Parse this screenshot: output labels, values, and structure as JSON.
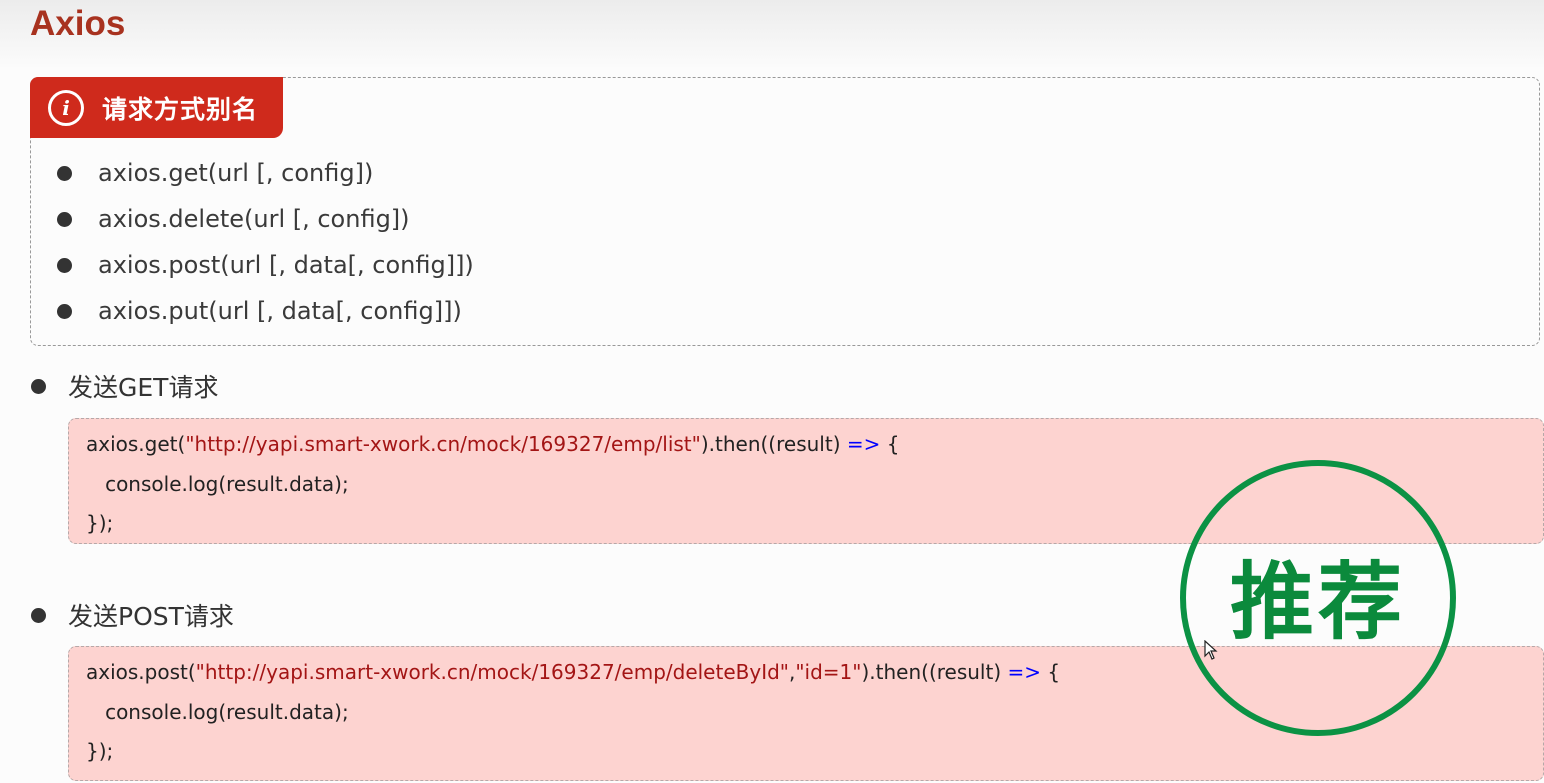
{
  "title": "Axios",
  "alias_panel": {
    "tag_label": "请求方式别名",
    "methods": [
      "axios.get(url [, config])",
      "axios.delete(url [, config])",
      "axios.post(url [, data[, config]])",
      "axios.put(url [, data[, config]])"
    ]
  },
  "get_section": {
    "heading": "发送GET请求",
    "code": {
      "l1_pre": "axios.get(",
      "l1_url": "\"http://yapi.smart-xwork.cn/mock/169327/emp/list\"",
      "l1_mid": ").then((result) ",
      "l1_arrow": "=>",
      "l1_post": " {",
      "l2": "   console.log(result.data);",
      "l3": "});"
    }
  },
  "post_section": {
    "heading": "发送POST请求",
    "code": {
      "l1_pre": "axios.post(",
      "l1_url": "\"http://yapi.smart-xwork.cn/mock/169327/emp/deleteById\"",
      "l1_sep": ",",
      "l1_body": "\"id=1\"",
      "l1_mid": ").then((result) ",
      "l1_arrow": "=>",
      "l1_post": " {",
      "l2": "   console.log(result.data);",
      "l3": "});"
    }
  },
  "stamp": {
    "text": "推荐",
    "color": "#0b9244"
  },
  "colors": {
    "title": "#a8321f",
    "tag": "#cf2a1c",
    "code_bg": "#fdd3d0",
    "string": "#a31515",
    "keyword": "#0000ff"
  }
}
